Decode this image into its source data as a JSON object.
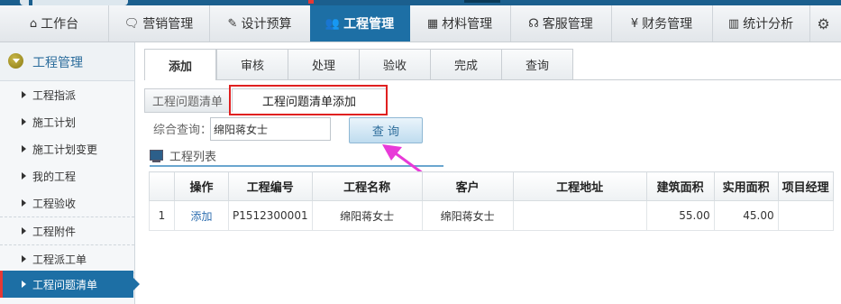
{
  "nav": {
    "items": [
      {
        "icon": "home-icon",
        "glyph": "⌂",
        "label": "工作台"
      },
      {
        "icon": "chat-icon",
        "glyph": "🗨",
        "label": "营销管理"
      },
      {
        "icon": "edit-icon",
        "glyph": "✎",
        "label": "设计预算"
      },
      {
        "icon": "users-icon",
        "glyph": "👥",
        "label": "工程管理"
      },
      {
        "icon": "grid-icon",
        "glyph": "▦",
        "label": "材料管理"
      },
      {
        "icon": "headset-icon",
        "glyph": "☊",
        "label": "客服管理"
      },
      {
        "icon": "yen-icon",
        "glyph": "¥",
        "label": "财务管理"
      },
      {
        "icon": "chart-icon",
        "glyph": "▥",
        "label": "统计分析"
      },
      {
        "icon": "gear-icon",
        "glyph": "⚙",
        "label": ""
      }
    ],
    "active_index": 3
  },
  "sidebar": {
    "title": "工程管理",
    "items": [
      {
        "label": "工程指派"
      },
      {
        "label": "施工计划"
      },
      {
        "label": "施工计划变更"
      },
      {
        "label": "我的工程"
      },
      {
        "label": "工程验收"
      },
      {
        "label": "工程附件"
      },
      {
        "label": "工程派工单"
      },
      {
        "label": "工程问题清单"
      }
    ],
    "active_index": 7
  },
  "tabs": {
    "top": [
      "添加",
      "审核",
      "处理",
      "验收",
      "完成",
      "查询"
    ],
    "top_active": 0,
    "sub": [
      "工程问题清单",
      "工程问题清单添加"
    ],
    "sub_active": 1
  },
  "query": {
    "label": "综合查询：",
    "value": "绵阳蒋女士",
    "button": "查 询"
  },
  "list": {
    "title": "工程列表",
    "columns": [
      "",
      "操作",
      "工程编号",
      "工程名称",
      "客户",
      "工程地址",
      "建筑面积",
      "实用面积",
      "项目经理"
    ],
    "rows": [
      {
        "index": "1",
        "action": "添加",
        "code": "P1512300001",
        "name": "绵阳蒋女士",
        "customer": "绵阳蒋女士",
        "address": "",
        "build_area": "55.00",
        "use_area": "45.00",
        "manager": ""
      }
    ]
  },
  "colors": {
    "accent": "#1d6fa5",
    "highlight_box": "#e02020",
    "annotation_arrow": "#e83ad8"
  }
}
